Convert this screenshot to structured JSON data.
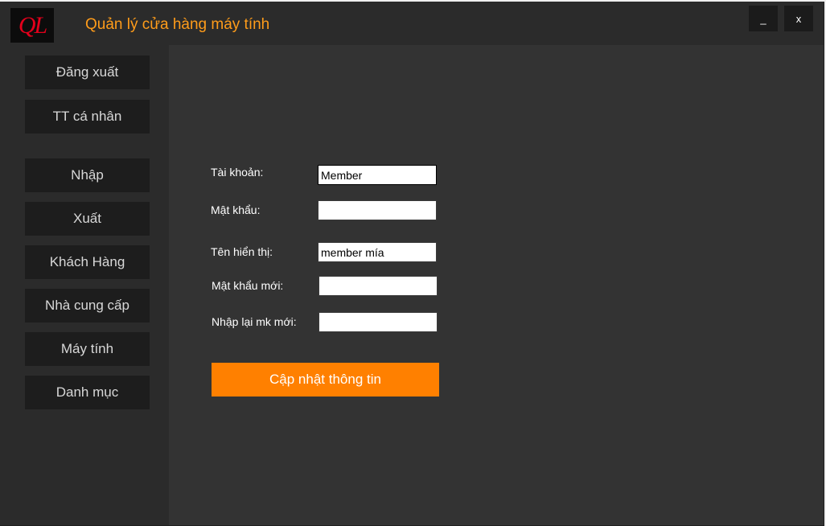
{
  "window": {
    "logo_text": "QL",
    "title": "Quản lý cửa hàng máy tính",
    "minimize_label": "_",
    "close_label": "x"
  },
  "sidebar": {
    "items": [
      {
        "label": "Đăng xuất"
      },
      {
        "label": "TT cá nhân"
      },
      {
        "label": "Nhập"
      },
      {
        "label": "Xuất"
      },
      {
        "label": "Khách Hàng"
      },
      {
        "label": "Nhà cung cấp"
      },
      {
        "label": "Máy tính"
      },
      {
        "label": "Danh mục"
      }
    ]
  },
  "form": {
    "account_label": "Tài khoản:",
    "account_value": "Member",
    "password_label": "Mật khẩu:",
    "password_value": "",
    "display_name_label": "Tên hiển thị:",
    "display_name_value": "member mía",
    "new_password_label": "Mật khẩu mới:",
    "new_password_value": "",
    "confirm_password_label": "Nhập lại mk mới:",
    "confirm_password_value": "",
    "submit_label": "Cập nhật thông tin"
  },
  "colors": {
    "accent": "#ff8000",
    "title_color": "#ff9c1a",
    "logo_color": "#e3001b",
    "background": "#333333",
    "sidebar": "#2b2b2b",
    "nav_button": "#1d1d1d"
  }
}
